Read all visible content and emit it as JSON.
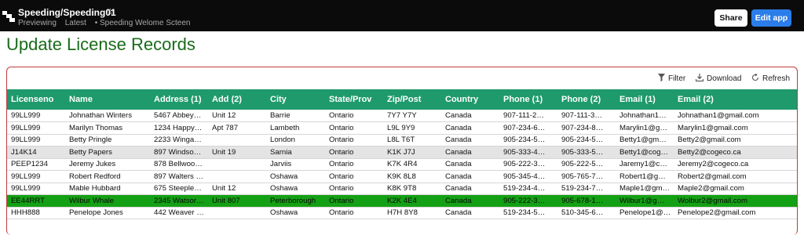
{
  "header": {
    "app_title": "Speeding/Speeding01",
    "status": "Previewing",
    "version": "Latest",
    "screen": "• Speeding Welome Scteen",
    "share_label": "Share",
    "edit_label": "Edit app",
    "icons": {
      "logo": "app-logo-icon",
      "star": "star-icon"
    }
  },
  "page_title": "Update License Records",
  "toolbar": {
    "filter_label": "Filter",
    "download_label": "Download",
    "refresh_label": "Refresh",
    "icons": {
      "filter": "filter-icon",
      "download": "download-icon",
      "refresh": "refresh-icon"
    }
  },
  "table": {
    "columns": [
      "Licenseno",
      "Name",
      "Address (1)",
      "Add (2)",
      "City",
      "State/Prov",
      "Zip/Post",
      "Country",
      "Phone (1)",
      "Phone (2)",
      "Email (1)",
      "Email (2)"
    ],
    "rows": [
      [
        "99LL999",
        "Johnathan Winters",
        "5467 Abbey…",
        "Unit 12",
        "Barrie",
        "Ontario",
        "7Y7 Y7Y",
        "Canada",
        "907-111-2…",
        "907-111-3…",
        "Johnathan1…",
        "Johnathan1@gmail.com"
      ],
      [
        "99LL999",
        "Marilyn Thomas",
        "1234 Happy…",
        "Apt 787",
        "Lambeth",
        "Ontario",
        "L9L 9Y9",
        "Canada",
        "907-234-6…",
        "907-234-8…",
        "Marylin1@g…",
        "Marylin1@gmail.com"
      ],
      [
        "99LL999",
        "Betty Pringle",
        "2233 Winga…",
        "",
        "London",
        "Ontario",
        "L8L T6T",
        "Canada",
        "905-234-5…",
        "905-234-5…",
        "Betty1@gm…",
        "Betty2@gmail.com"
      ],
      [
        "J14K14",
        "Betty Papers",
        "897 Windso…",
        "Unit 19",
        "Sarnia",
        "Ontario",
        "K1K J7J",
        "Canada",
        "905-333-4…",
        "905-333-5…",
        "Betty1@cog…",
        "Betty2@cogeco.ca"
      ],
      [
        "PEEP1234",
        "Jeremy Jukes",
        "878 Bellwoo…",
        "",
        "Jarviis",
        "Ontario",
        "K7K 4R4",
        "Canada",
        "905-222-3…",
        "905-222-5…",
        "Jaremy1@c…",
        "Jeremy2@cogeco.ca"
      ],
      [
        "99LL999",
        "Robert Redford",
        "897 Walters …",
        "",
        "Oshawa",
        "Ontario",
        "K9K 8L8",
        "Canada",
        "905-345-4…",
        "905-765-7…",
        "Robert1@g…",
        "Robert2@gmail.com"
      ],
      [
        "99LL999",
        "Mable Hubbard",
        "675 Steeple…",
        "Unit 12",
        "Oshawa",
        "Ontario",
        "K8K 9T8",
        "Canada",
        "519-234-4…",
        "519-234-7…",
        "Maple1@gm…",
        "Maple2@gmail.com"
      ],
      [
        "EE44RRT",
        "Wilbur Whale",
        "2345 Watsor…",
        "Unit 807",
        "Peterborough",
        "Ontario",
        "K2K 4E4",
        "Canada",
        "905-222-3…",
        "905-678-1…",
        "Wilbur1@g…",
        "Wolbur2@gmail.com"
      ],
      [
        "HHH888",
        "Penelope Jones",
        "442 Weaver …",
        "",
        "Oshawa",
        "Ontario",
        "H7H 8Y8",
        "Canada",
        "519-234-5…",
        "510-345-6…",
        "Penelope1@…",
        "Penelope2@gmail.com"
      ]
    ],
    "hover_row": 3,
    "selected_row": 7
  },
  "colors": {
    "topbar": "#0b0b0b",
    "title_green": "#1a6b1a",
    "header_green": "#1f9a6d",
    "selected_green": "#14a014",
    "edit_button_blue": "#2b7de9",
    "card_border": "#c23a3a"
  }
}
